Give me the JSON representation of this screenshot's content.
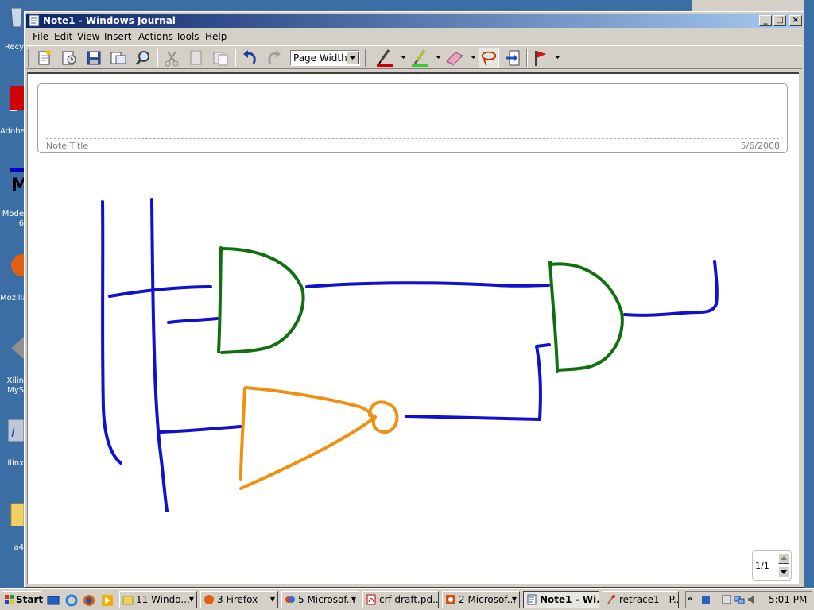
{
  "window": {
    "title": "Note1 - Windows Journal",
    "controls": [
      "_",
      "□",
      "×"
    ]
  },
  "menu": [
    "File",
    "Edit",
    "View",
    "Insert",
    "Actions",
    "Tools",
    "Help"
  ],
  "toolbar": {
    "zoom_value": "Page Width",
    "buttons": [
      "new-note-icon",
      "new-note-from-template-icon",
      "save-icon",
      "send-icon",
      "find-icon",
      "cut-icon",
      "copy-icon",
      "paste-icon",
      "undo-icon",
      "redo-icon",
      "pen-icon",
      "highlighter-icon",
      "eraser-icon",
      "lasso-select-icon",
      "insert-space-icon",
      "flag-icon"
    ],
    "pen_color": "#d00000",
    "highlighter_color": "#33cc33"
  },
  "note": {
    "title_label": "Note Title",
    "date": "5/6/2008",
    "page_indicator": "1/1",
    "ink_colors": {
      "wires": "#1010d0",
      "and_gates": "#107010",
      "not_gate": "#f09010"
    }
  },
  "desktop": {
    "icons": [
      {
        "label": "Recy",
        "icon": "recycle-bin-icon"
      },
      {
        "label": "Adobe",
        "icon": "adobe-reader-icon"
      },
      {
        "label": "Mode\n6",
        "icon": "modelsim-icon"
      },
      {
        "label": "Mozilla",
        "icon": "firefox-icon"
      },
      {
        "label": "Xilin\nMyS",
        "icon": "xilinx-icon"
      },
      {
        "label": "ilinx",
        "icon": "xilinx-ise-icon"
      },
      {
        "label": "a4",
        "icon": "folder-icon"
      }
    ]
  },
  "taskbar": {
    "start_label": "Start",
    "tasks": [
      {
        "label": "11 Windo...",
        "icon": "folder-icon",
        "grouped": true
      },
      {
        "label": "3 Firefox",
        "icon": "firefox-icon",
        "grouped": true
      },
      {
        "label": "5 Microsof...",
        "icon": "office-icon",
        "grouped": true
      },
      {
        "label": "crf-draft.pd...",
        "icon": "pdf-icon",
        "grouped": false
      },
      {
        "label": "2 Microsof...",
        "icon": "powerpoint-icon",
        "grouped": true
      },
      {
        "label": "Note1 - Wi...",
        "icon": "journal-icon",
        "grouped": false,
        "active": true
      },
      {
        "label": "retrace1 - P...",
        "icon": "paint-icon",
        "grouped": false
      }
    ],
    "tray_chevron": "«",
    "clock": "5:01 PM"
  }
}
